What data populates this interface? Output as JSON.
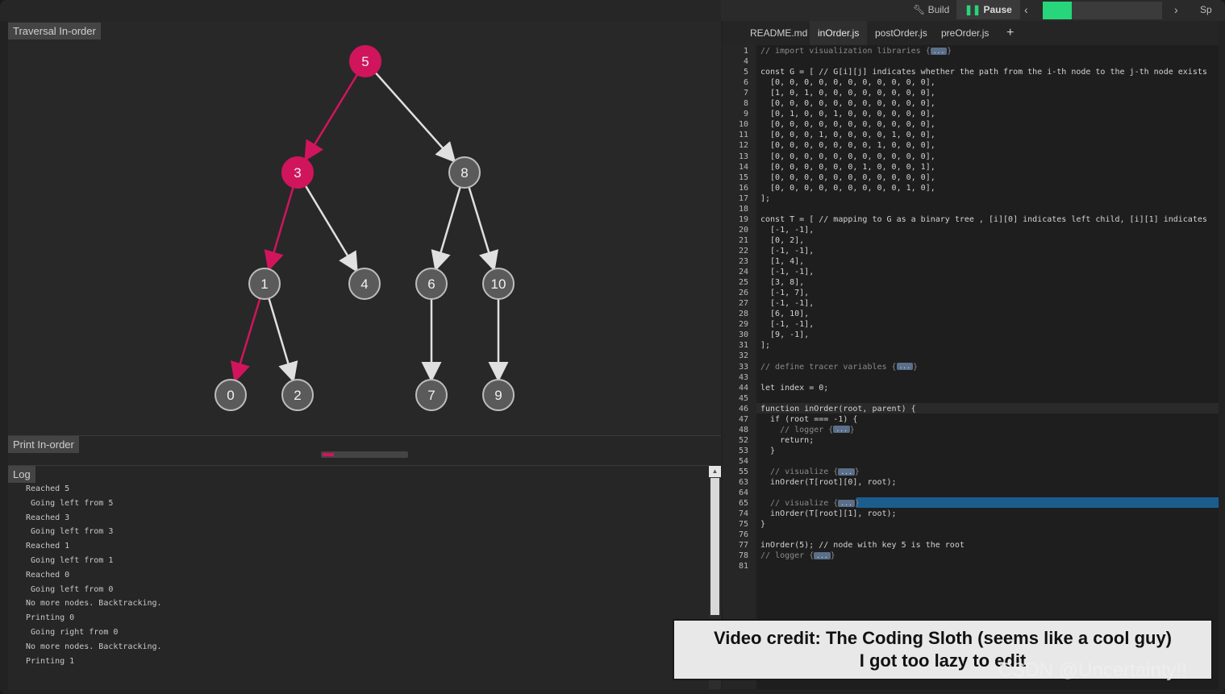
{
  "toolbar": {
    "build_label": "Build",
    "pause_label": "Pause",
    "prev_icon": "chevron-left-icon",
    "next_icon": "chevron-right-icon",
    "speed_label": "Sp"
  },
  "panels": {
    "graph_title": "Traversal In-order",
    "print_title": "Print In-order",
    "log_title": "Log"
  },
  "tree": {
    "nodes": [
      {
        "key": "5",
        "active": true
      },
      {
        "key": "3",
        "active": true
      },
      {
        "key": "8",
        "active": false
      },
      {
        "key": "1",
        "active": false
      },
      {
        "key": "4",
        "active": false
      },
      {
        "key": "6",
        "active": false
      },
      {
        "key": "10",
        "active": false
      },
      {
        "key": "0",
        "active": false
      },
      {
        "key": "2",
        "active": false
      },
      {
        "key": "7",
        "active": false
      },
      {
        "key": "9",
        "active": false
      }
    ],
    "highlight_color": "#d0155c",
    "node_color": "#5a5a5a"
  },
  "log": [
    "Reached 5",
    " Going left from 5",
    "Reached 3",
    " Going left from 3",
    "Reached 1",
    " Going left from 1",
    "Reached 0",
    " Going left from 0",
    "No more nodes. Backtracking.",
    "Printing 0",
    " Going right from 0",
    "No more nodes. Backtracking.",
    "Printing 1"
  ],
  "editor": {
    "tabs": [
      "README.md",
      "inOrder.js",
      "postOrder.js",
      "preOrder.js"
    ],
    "active_tab": "inOrder.js",
    "add_tab": "+",
    "lines": [
      {
        "n": "1",
        "t": "// import visualization libraries {",
        "fold": true
      },
      {
        "n": "4",
        "t": ""
      },
      {
        "n": "5",
        "t": "const G = [ // G[i][j] indicates whether the path from the i-th node to the j-th node exists"
      },
      {
        "n": "6",
        "t": "  [0, 0, 0, 0, 0, 0, 0, 0, 0, 0, 0],"
      },
      {
        "n": "7",
        "t": "  [1, 0, 1, 0, 0, 0, 0, 0, 0, 0, 0],"
      },
      {
        "n": "8",
        "t": "  [0, 0, 0, 0, 0, 0, 0, 0, 0, 0, 0],"
      },
      {
        "n": "9",
        "t": "  [0, 1, 0, 0, 1, 0, 0, 0, 0, 0, 0],"
      },
      {
        "n": "10",
        "t": "  [0, 0, 0, 0, 0, 0, 0, 0, 0, 0, 0],"
      },
      {
        "n": "11",
        "t": "  [0, 0, 0, 1, 0, 0, 0, 0, 1, 0, 0],"
      },
      {
        "n": "12",
        "t": "  [0, 0, 0, 0, 0, 0, 0, 1, 0, 0, 0],"
      },
      {
        "n": "13",
        "t": "  [0, 0, 0, 0, 0, 0, 0, 0, 0, 0, 0],"
      },
      {
        "n": "14",
        "t": "  [0, 0, 0, 0, 0, 0, 1, 0, 0, 0, 1],"
      },
      {
        "n": "15",
        "t": "  [0, 0, 0, 0, 0, 0, 0, 0, 0, 0, 0],"
      },
      {
        "n": "16",
        "t": "  [0, 0, 0, 0, 0, 0, 0, 0, 0, 1, 0],"
      },
      {
        "n": "17",
        "t": "];"
      },
      {
        "n": "18",
        "t": ""
      },
      {
        "n": "19",
        "t": "const T = [ // mapping to G as a binary tree , [i][0] indicates left child, [i][1] indicates"
      },
      {
        "n": "20",
        "t": "  [-1, -1],"
      },
      {
        "n": "21",
        "t": "  [0, 2],"
      },
      {
        "n": "22",
        "t": "  [-1, -1],"
      },
      {
        "n": "23",
        "t": "  [1, 4],"
      },
      {
        "n": "24",
        "t": "  [-1, -1],"
      },
      {
        "n": "25",
        "t": "  [3, 8],"
      },
      {
        "n": "26",
        "t": "  [-1, 7],"
      },
      {
        "n": "27",
        "t": "  [-1, -1],"
      },
      {
        "n": "28",
        "t": "  [6, 10],"
      },
      {
        "n": "29",
        "t": "  [-1, -1],"
      },
      {
        "n": "30",
        "t": "  [9, -1],"
      },
      {
        "n": "31",
        "t": "];"
      },
      {
        "n": "32",
        "t": ""
      },
      {
        "n": "33",
        "t": "// define tracer variables {",
        "fold": true
      },
      {
        "n": "43",
        "t": ""
      },
      {
        "n": "44",
        "t": "let index = 0;"
      },
      {
        "n": "45",
        "t": ""
      },
      {
        "n": "46",
        "t": "function inOrder(root, parent) {"
      },
      {
        "n": "47",
        "t": "  if (root === -1) {"
      },
      {
        "n": "48",
        "t": "    // logger {",
        "fold": true
      },
      {
        "n": "52",
        "t": "    return;"
      },
      {
        "n": "53",
        "t": "  }"
      },
      {
        "n": "54",
        "t": ""
      },
      {
        "n": "55",
        "t": "  // visualize {",
        "fold": true
      },
      {
        "n": "63",
        "t": "  inOrder(T[root][0], root);"
      },
      {
        "n": "64",
        "t": ""
      },
      {
        "n": "65",
        "t": "  // visualize {",
        "fold": true
      },
      {
        "n": "74",
        "t": "  inOrder(T[root][1], root);"
      },
      {
        "n": "75",
        "t": "}"
      },
      {
        "n": "76",
        "t": ""
      },
      {
        "n": "77",
        "t": "inOrder(5); // node with key 5 is the root"
      },
      {
        "n": "78",
        "t": "// logger {",
        "fold": true
      },
      {
        "n": "81",
        "t": ""
      }
    ]
  },
  "caption": {
    "line1": "Video credit: The Coding Sloth (seems like a cool guy)",
    "line2": "I got too lazy to edit"
  },
  "watermark": "CSDN @Uncertainty!!",
  "colors": {
    "accent_green": "#27d67a",
    "highlight_pink": "#d0155c",
    "selection_blue": "#1d5d8e"
  }
}
